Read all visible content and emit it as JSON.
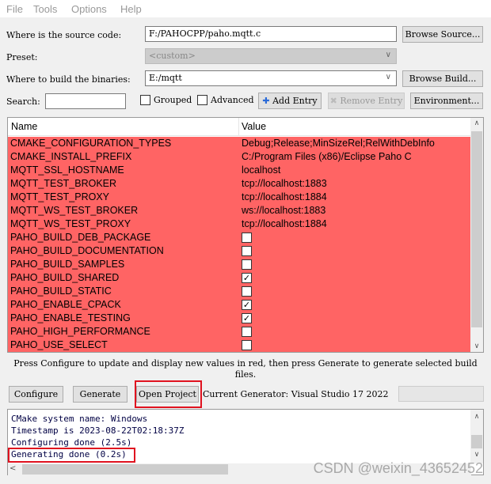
{
  "menu": [
    "File",
    "Tools",
    "Options",
    "Help"
  ],
  "source": {
    "label": "Where is the source code:",
    "value": "F:/PAHOCPP/paho.mqtt.c",
    "button": "Browse Source..."
  },
  "preset": {
    "label": "Preset:",
    "value": "<custom>"
  },
  "build": {
    "label": "Where to build the binaries:",
    "value": "E:/mqtt",
    "button": "Browse Build..."
  },
  "search": {
    "label": "Search:",
    "value": ""
  },
  "options": {
    "grouped": "Grouped",
    "advanced": "Advanced",
    "add_entry": "Add Entry",
    "remove_entry": "Remove Entry",
    "environment": "Environment..."
  },
  "table": {
    "headers": [
      "Name",
      "Value"
    ],
    "row_color": "#ff6464",
    "rows": [
      {
        "name": "CMAKE_CONFIGURATION_TYPES",
        "value": "Debug;Release;MinSizeRel;RelWithDebInfo"
      },
      {
        "name": "CMAKE_INSTALL_PREFIX",
        "value": "C:/Program Files (x86)/Eclipse Paho C"
      },
      {
        "name": "MQTT_SSL_HOSTNAME",
        "value": "localhost"
      },
      {
        "name": "MQTT_TEST_BROKER",
        "value": "tcp://localhost:1883"
      },
      {
        "name": "MQTT_TEST_PROXY",
        "value": "tcp://localhost:1884"
      },
      {
        "name": "MQTT_WS_TEST_BROKER",
        "value": "ws://localhost:1883"
      },
      {
        "name": "MQTT_WS_TEST_PROXY",
        "value": "tcp://localhost:1884"
      },
      {
        "name": "PAHO_BUILD_DEB_PACKAGE",
        "checked": false
      },
      {
        "name": "PAHO_BUILD_DOCUMENTATION",
        "checked": false
      },
      {
        "name": "PAHO_BUILD_SAMPLES",
        "checked": false
      },
      {
        "name": "PAHO_BUILD_SHARED",
        "checked": true
      },
      {
        "name": "PAHO_BUILD_STATIC",
        "checked": false
      },
      {
        "name": "PAHO_ENABLE_CPACK",
        "checked": true
      },
      {
        "name": "PAHO_ENABLE_TESTING",
        "checked": true
      },
      {
        "name": "PAHO_HIGH_PERFORMANCE",
        "checked": false
      },
      {
        "name": "PAHO_USE_SELECT",
        "checked": false
      }
    ]
  },
  "hint": "Press Configure to update and display new values in red, then press Generate to generate selected build files.",
  "actions": {
    "configure": "Configure",
    "generate": "Generate",
    "open_project": "Open Project",
    "generator": "Current Generator: Visual Studio 17 2022"
  },
  "log": [
    "CMake system name: Windows",
    "Timestamp is 2023-08-22T02:18:37Z",
    "Configuring done (2.5s)",
    "Generating done (0.2s)"
  ],
  "watermark": "CSDN @weixin_43652452"
}
